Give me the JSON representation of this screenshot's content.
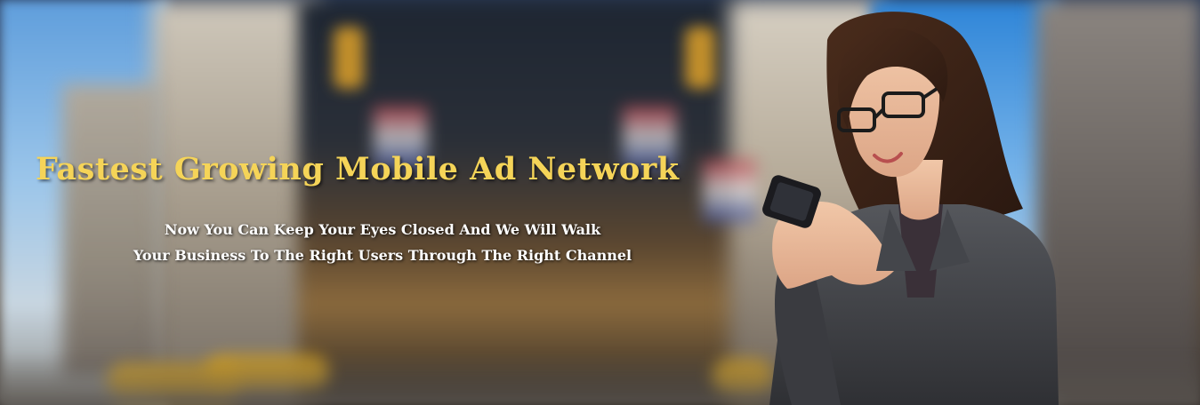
{
  "banner": {
    "headline": "Fastest Growing Mobile Ad Network",
    "subtext_line1": "Now You Can Keep Your Eyes Closed And We Will Walk",
    "subtext_line2": "Your Business To The Right Users Through The Right Channel",
    "headline_color": "#f5d458",
    "subtext_color": "#ffffff",
    "background_image": "blurred-city-street-photo",
    "person_image": "woman-with-smartphone-photo"
  }
}
